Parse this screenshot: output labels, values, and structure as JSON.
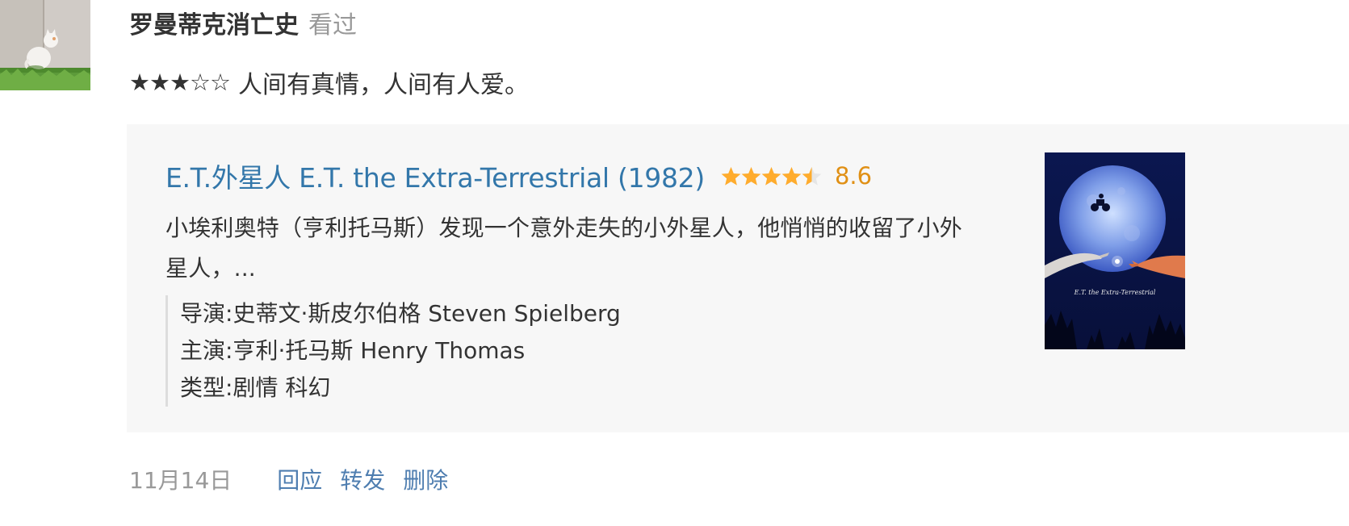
{
  "user": {
    "name": "罗曼蒂克消亡史",
    "action": "看过"
  },
  "rating": {
    "stars_display": "★★★☆☆",
    "user_rating": 3,
    "max": 5,
    "comment": "人间有真情，人间有人爱。"
  },
  "movie": {
    "title": "E.T.外星人 E.T. the Extra-Terrestrial (1982)",
    "score": "8.6",
    "score_stars": 4.5,
    "synopsis": "小埃利奥特（亨利托马斯）发现一个意外走失的小外星人，他悄悄的收留了小外星人，...",
    "credits": [
      {
        "label": "导演:",
        "value": "史蒂文·斯皮尔伯格 Steven Spielberg"
      },
      {
        "label": "主演:",
        "value": "亨利·托马斯 Henry Thomas"
      },
      {
        "label": "类型:",
        "value": "剧情 科幻"
      }
    ]
  },
  "footer": {
    "date": "11月14日",
    "reply": "回应",
    "forward": "转发",
    "delete": "删除"
  },
  "colors": {
    "link": "#3377aa",
    "score": "#e09015",
    "star_fill": "#ffac2d",
    "star_empty": "#e6e6e6",
    "card_bg": "#f7f7f7",
    "muted": "#999999"
  }
}
